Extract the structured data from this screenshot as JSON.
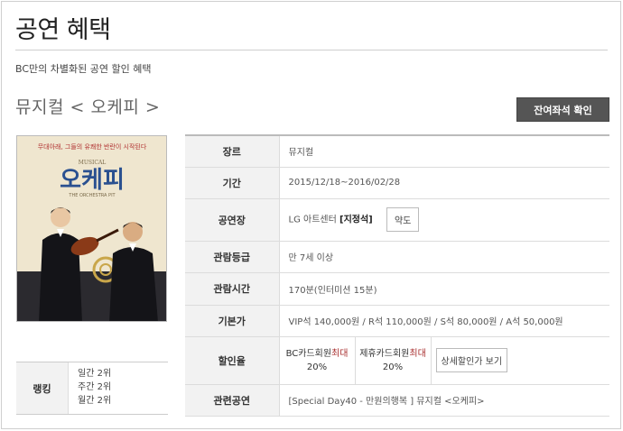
{
  "header": {
    "title": "공연 혜택",
    "subtitle": "BC만의 차별화된 공연 할인 혜택"
  },
  "show": {
    "title": "뮤지컬 < 오케피 >",
    "seat_button": "잔여좌석 확인"
  },
  "poster": {
    "top_text": "무대아래, 그들의 유쾌한 반란이 시작된다",
    "title_text": "오케피",
    "subtitle_text": "MUSICAL",
    "eng_title": "THE ORCHESTRA PIT"
  },
  "ranking": {
    "label": "랭킹",
    "items": [
      "일간 2위",
      "주간 2위",
      "월간 2위"
    ]
  },
  "info": {
    "genre_label": "장르",
    "genre": "뮤지컬",
    "period_label": "기간",
    "period": "2015/12/18~2016/02/28",
    "venue_label": "공연장",
    "venue": "LG 아트센터",
    "venue_tag": "[지정석]",
    "map_button": "약도",
    "age_label": "관람등급",
    "age": "만 7세 이상",
    "runtime_label": "관람시간",
    "runtime": "170분(인터미션 15분)",
    "price_label": "기본가",
    "price": "VIP석 140,000원 / R석 110,000원 / S석 80,000원 / A석 50,000원",
    "discount_label": "할인율",
    "discount_bc_name": "BC카드회원",
    "discount_bc_max": "최대",
    "discount_bc_rate": "20%",
    "discount_partner_name": "제휴카드회원",
    "discount_partner_max": "최대",
    "discount_partner_rate": "20%",
    "discount_detail_button": "상세할인가 보기",
    "related_label": "관련공연",
    "related": "[Special Day40 - 만원의행복 ] 뮤지컬 <오케피>"
  }
}
